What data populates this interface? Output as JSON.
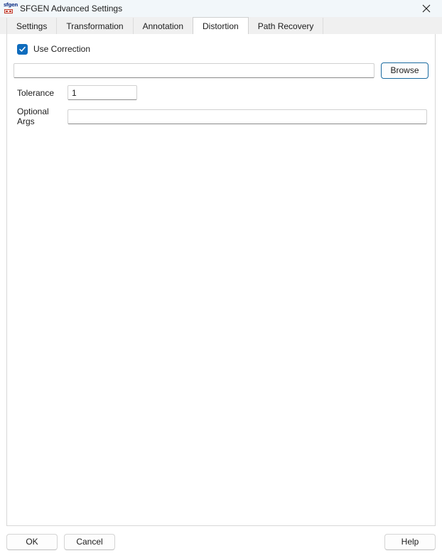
{
  "window": {
    "title": "SFGEN Advanced Settings",
    "icon": "sfgen-app-icon",
    "icon_text": "sfgen",
    "close_icon": "close-icon",
    "accent_color": "#0f6cbd",
    "titlebar_color": "#f2f7fa"
  },
  "tabs": [
    {
      "label": "Settings",
      "active": false
    },
    {
      "label": "Transformation",
      "active": false
    },
    {
      "label": "Annotation",
      "active": false
    },
    {
      "label": "Distortion",
      "active": true
    },
    {
      "label": "Path Recovery",
      "active": false
    }
  ],
  "distortion": {
    "use_correction": {
      "label": "Use Correction",
      "checked": true
    },
    "path": {
      "value": "",
      "placeholder": ""
    },
    "browse_label": "Browse",
    "tolerance": {
      "label": "Tolerance",
      "value": "1",
      "placeholder": ""
    },
    "optional_args": {
      "label": "Optional Args",
      "value": "",
      "placeholder": ""
    }
  },
  "footer": {
    "ok_label": "OK",
    "cancel_label": "Cancel",
    "help_label": "Help"
  }
}
